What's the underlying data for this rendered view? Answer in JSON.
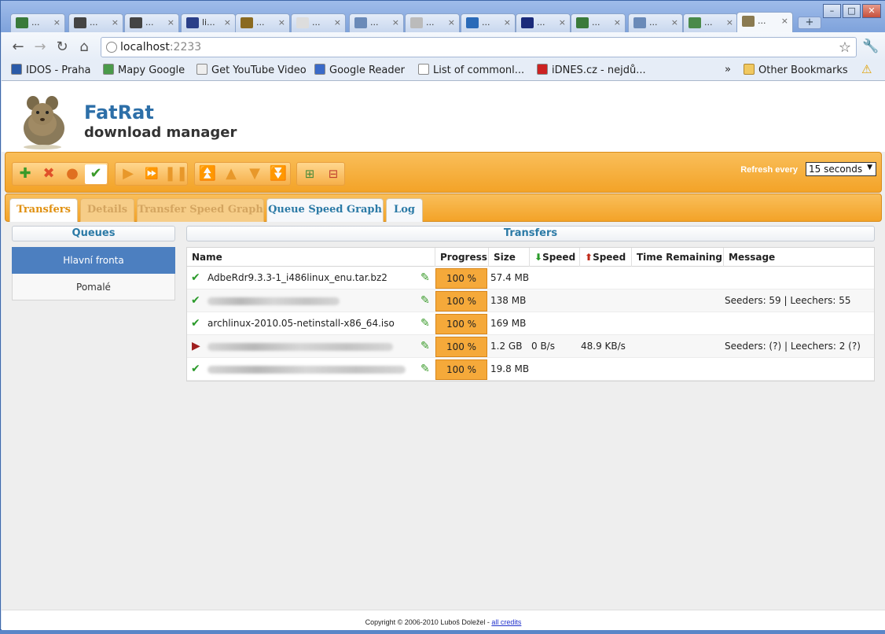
{
  "browser": {
    "tabs": [
      {
        "label": "...",
        "color": "#3a7a3a"
      },
      {
        "label": "...",
        "color": "#444444"
      },
      {
        "label": "...",
        "color": "#444444"
      },
      {
        "label": "li...",
        "color": "#2a3f88"
      },
      {
        "label": "...",
        "color": "#8a6a20"
      },
      {
        "label": "...",
        "color": "#dddddd"
      },
      {
        "label": "...",
        "color": "#6a8ab8"
      },
      {
        "label": "...",
        "color": "#bbbbbb"
      },
      {
        "label": "...",
        "color": "#2a6ab8"
      },
      {
        "label": "...",
        "color": "#1a2a7a"
      },
      {
        "label": "...",
        "color": "#3a7a3a"
      },
      {
        "label": "...",
        "color": "#6a8ab8"
      },
      {
        "label": "...",
        "color": "#4a8a4a"
      },
      {
        "label": "...",
        "color": "#8a7a50"
      }
    ],
    "address": {
      "host": "localhost",
      "port": ":2233"
    },
    "bookmarks": [
      {
        "label": "IDOS - Praha",
        "icon": "idos-icon",
        "color": "#2a5aa8"
      },
      {
        "label": "Mapy Google",
        "icon": "google-maps-icon",
        "color": "#4a9a4a"
      },
      {
        "label": "Get YouTube Video",
        "icon": "page-icon",
        "color": "#eeeeee"
      },
      {
        "label": "Google Reader",
        "icon": "google-reader-icon",
        "color": "#3a6ac8"
      },
      {
        "label": "List of commonl...",
        "icon": "wikipedia-icon",
        "color": "#ffffff"
      },
      {
        "label": "iDNES.cz - nejdů...",
        "icon": "idnes-icon",
        "color": "#cc2222"
      }
    ],
    "other_bookmarks": "Other Bookmarks",
    "overflow": "»"
  },
  "app": {
    "title": "FatRat",
    "subtitle": "download manager",
    "refresh_label": "Refresh every",
    "refresh_value": "15 seconds",
    "tabs": [
      "Transfers",
      "Details",
      "Transfer Speed Graph",
      "Queue Speed Graph",
      "Log"
    ],
    "queues_title": "Queues",
    "queues": [
      "Hlavní fronta",
      "Pomalé"
    ],
    "transfers_title": "Transfers",
    "columns": {
      "name": "Name",
      "progress": "Progress",
      "size": "Size",
      "down_speed": "Speed",
      "up_speed": "Speed",
      "time_remaining": "Time Remaining",
      "message": "Message"
    },
    "transfers": [
      {
        "status": "completed",
        "name": "AdbeRdr9.3.3-1_i486linux_enu.tar.bz2",
        "progress": "100 %",
        "size": "57.4 MB",
        "down": "",
        "up": "",
        "time": "",
        "message": ""
      },
      {
        "status": "completed",
        "name": "",
        "progress": "100 %",
        "size": "138 MB",
        "down": "",
        "up": "",
        "time": "",
        "message": "Seeders: 59 | Leechers: 55"
      },
      {
        "status": "completed",
        "name": "archlinux-2010.05-netinstall-x86_64.iso",
        "progress": "100 %",
        "size": "169 MB",
        "down": "",
        "up": "",
        "time": "",
        "message": ""
      },
      {
        "status": "seeding",
        "name": "",
        "progress": "100 %",
        "size": "1.2 GB",
        "down": "0 B/s",
        "up": "48.9 KB/s",
        "time": "",
        "message": "Seeders: (?) | Leechers: 2 (?)"
      },
      {
        "status": "completed",
        "name": "",
        "progress": "100 %",
        "size": "19.8 MB",
        "down": "",
        "up": "",
        "time": "",
        "message": ""
      }
    ],
    "footer": {
      "text": "Copyright © 2006-2010 Luboš Doležel - ",
      "link": "all credits"
    }
  }
}
